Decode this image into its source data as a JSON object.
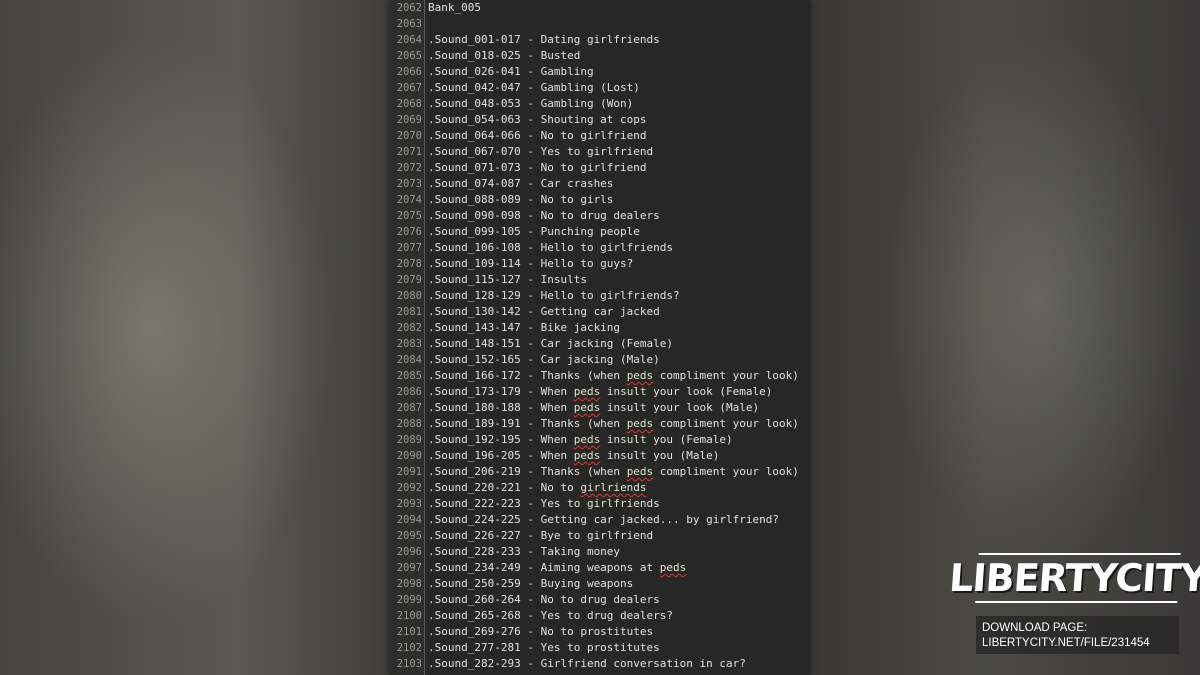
{
  "editor": {
    "lines": [
      {
        "n": "2062",
        "parts": [
          {
            "t": "Bank_005"
          }
        ]
      },
      {
        "n": "2063",
        "parts": [
          {
            "t": ""
          }
        ]
      },
      {
        "n": "2064",
        "parts": [
          {
            "t": ".Sound_001-017 - Dating girlfriends"
          }
        ]
      },
      {
        "n": "2065",
        "parts": [
          {
            "t": ".Sound_018-025 - Busted"
          }
        ]
      },
      {
        "n": "2066",
        "parts": [
          {
            "t": ".Sound_026-041 - Gambling"
          }
        ]
      },
      {
        "n": "2067",
        "parts": [
          {
            "t": ".Sound_042-047 - Gambling (Lost)"
          }
        ]
      },
      {
        "n": "2068",
        "parts": [
          {
            "t": ".Sound_048-053 - Gambling (Won)"
          }
        ]
      },
      {
        "n": "2069",
        "parts": [
          {
            "t": ".Sound_054-063 - Shouting at cops"
          }
        ]
      },
      {
        "n": "2070",
        "parts": [
          {
            "t": ".Sound_064-066 - No to girlfriend"
          }
        ]
      },
      {
        "n": "2071",
        "parts": [
          {
            "t": ".Sound_067-070 - Yes to girlfriend"
          }
        ]
      },
      {
        "n": "2072",
        "parts": [
          {
            "t": ".Sound_071-073 - No to girlfriend"
          }
        ]
      },
      {
        "n": "2073",
        "parts": [
          {
            "t": ".Sound_074-087 - Car crashes"
          }
        ]
      },
      {
        "n": "2074",
        "parts": [
          {
            "t": ".Sound_088-089 - No to girls"
          }
        ]
      },
      {
        "n": "2075",
        "parts": [
          {
            "t": ".Sound_090-098 - No to drug dealers"
          }
        ]
      },
      {
        "n": "2076",
        "parts": [
          {
            "t": ".Sound_099-105 - Punching people"
          }
        ]
      },
      {
        "n": "2077",
        "parts": [
          {
            "t": ".Sound_106-108 - Hello to girlfriends"
          }
        ]
      },
      {
        "n": "2078",
        "parts": [
          {
            "t": ".Sound_109-114 - Hello to guys?"
          }
        ]
      },
      {
        "n": "2079",
        "parts": [
          {
            "t": ".Sound_115-127 - Insults"
          }
        ]
      },
      {
        "n": "2080",
        "parts": [
          {
            "t": ".Sound_128-129 - Hello to girlfriends?"
          }
        ]
      },
      {
        "n": "2081",
        "parts": [
          {
            "t": ".Sound_130-142 - Getting car jacked"
          }
        ]
      },
      {
        "n": "2082",
        "parts": [
          {
            "t": ".Sound_143-147 - Bike jacking"
          }
        ]
      },
      {
        "n": "2083",
        "parts": [
          {
            "t": ".Sound_148-151 - Car jacking (Female)"
          }
        ]
      },
      {
        "n": "2084",
        "parts": [
          {
            "t": ".Sound_152-165 - Car jacking (Male)"
          }
        ]
      },
      {
        "n": "2085",
        "parts": [
          {
            "t": ".Sound_166-172 - Thanks (when "
          },
          {
            "t": "peds",
            "s": true
          },
          {
            "t": " compliment your look)"
          }
        ]
      },
      {
        "n": "2086",
        "parts": [
          {
            "t": ".Sound_173-179 - When "
          },
          {
            "t": "peds",
            "s": true
          },
          {
            "t": " insult your look (Female)"
          }
        ]
      },
      {
        "n": "2087",
        "parts": [
          {
            "t": ".Sound_180-188 - When "
          },
          {
            "t": "peds",
            "s": true
          },
          {
            "t": " insult your look (Male)"
          }
        ]
      },
      {
        "n": "2088",
        "parts": [
          {
            "t": ".Sound_189-191 - Thanks (when "
          },
          {
            "t": "peds",
            "s": true
          },
          {
            "t": " compliment your look)"
          }
        ]
      },
      {
        "n": "2089",
        "parts": [
          {
            "t": ".Sound_192-195 - When "
          },
          {
            "t": "peds",
            "s": true
          },
          {
            "t": " insult you (Female)"
          }
        ]
      },
      {
        "n": "2090",
        "parts": [
          {
            "t": ".Sound_196-205 - When "
          },
          {
            "t": "peds",
            "s": true
          },
          {
            "t": " insult you (Male)"
          }
        ]
      },
      {
        "n": "2091",
        "parts": [
          {
            "t": ".Sound_206-219 - Thanks (when "
          },
          {
            "t": "peds",
            "s": true
          },
          {
            "t": " compliment your look)"
          }
        ]
      },
      {
        "n": "2092",
        "parts": [
          {
            "t": ".Sound_220-221 - No to "
          },
          {
            "t": "girlriends",
            "s": true
          }
        ]
      },
      {
        "n": "2093",
        "parts": [
          {
            "t": ".Sound_222-223 - Yes to girlfriends"
          }
        ]
      },
      {
        "n": "2094",
        "parts": [
          {
            "t": ".Sound_224-225 - Getting car jacked... by girlfriend?"
          }
        ]
      },
      {
        "n": "2095",
        "parts": [
          {
            "t": ".Sound_226-227 - Bye to girlfriend"
          }
        ]
      },
      {
        "n": "2096",
        "parts": [
          {
            "t": ".Sound_228-233 - Taking money"
          }
        ]
      },
      {
        "n": "2097",
        "parts": [
          {
            "t": ".Sound_234-249 - Aiming weapons at "
          },
          {
            "t": "peds",
            "s": true
          }
        ]
      },
      {
        "n": "2098",
        "parts": [
          {
            "t": ".Sound_250-259 - Buying weapons"
          }
        ]
      },
      {
        "n": "2099",
        "parts": [
          {
            "t": ".Sound_260-264 - No to drug dealers"
          }
        ]
      },
      {
        "n": "2100",
        "parts": [
          {
            "t": ".Sound_265-268 - Yes to drug dealers?"
          }
        ]
      },
      {
        "n": "2101",
        "parts": [
          {
            "t": ".Sound_269-276 - No to prostitutes"
          }
        ]
      },
      {
        "n": "2102",
        "parts": [
          {
            "t": ".Sound_277-281 - Yes to prostitutes"
          }
        ]
      },
      {
        "n": "2103",
        "parts": [
          {
            "t": ".Sound_282-293 - Girlfriend conversation in car?"
          }
        ]
      }
    ]
  },
  "branding": {
    "logo_text": "LIBERTYCITY",
    "download_label": "DOWNLOAD PAGE:",
    "download_url": "LIBERTYCITY.NET/FILE/231454"
  }
}
